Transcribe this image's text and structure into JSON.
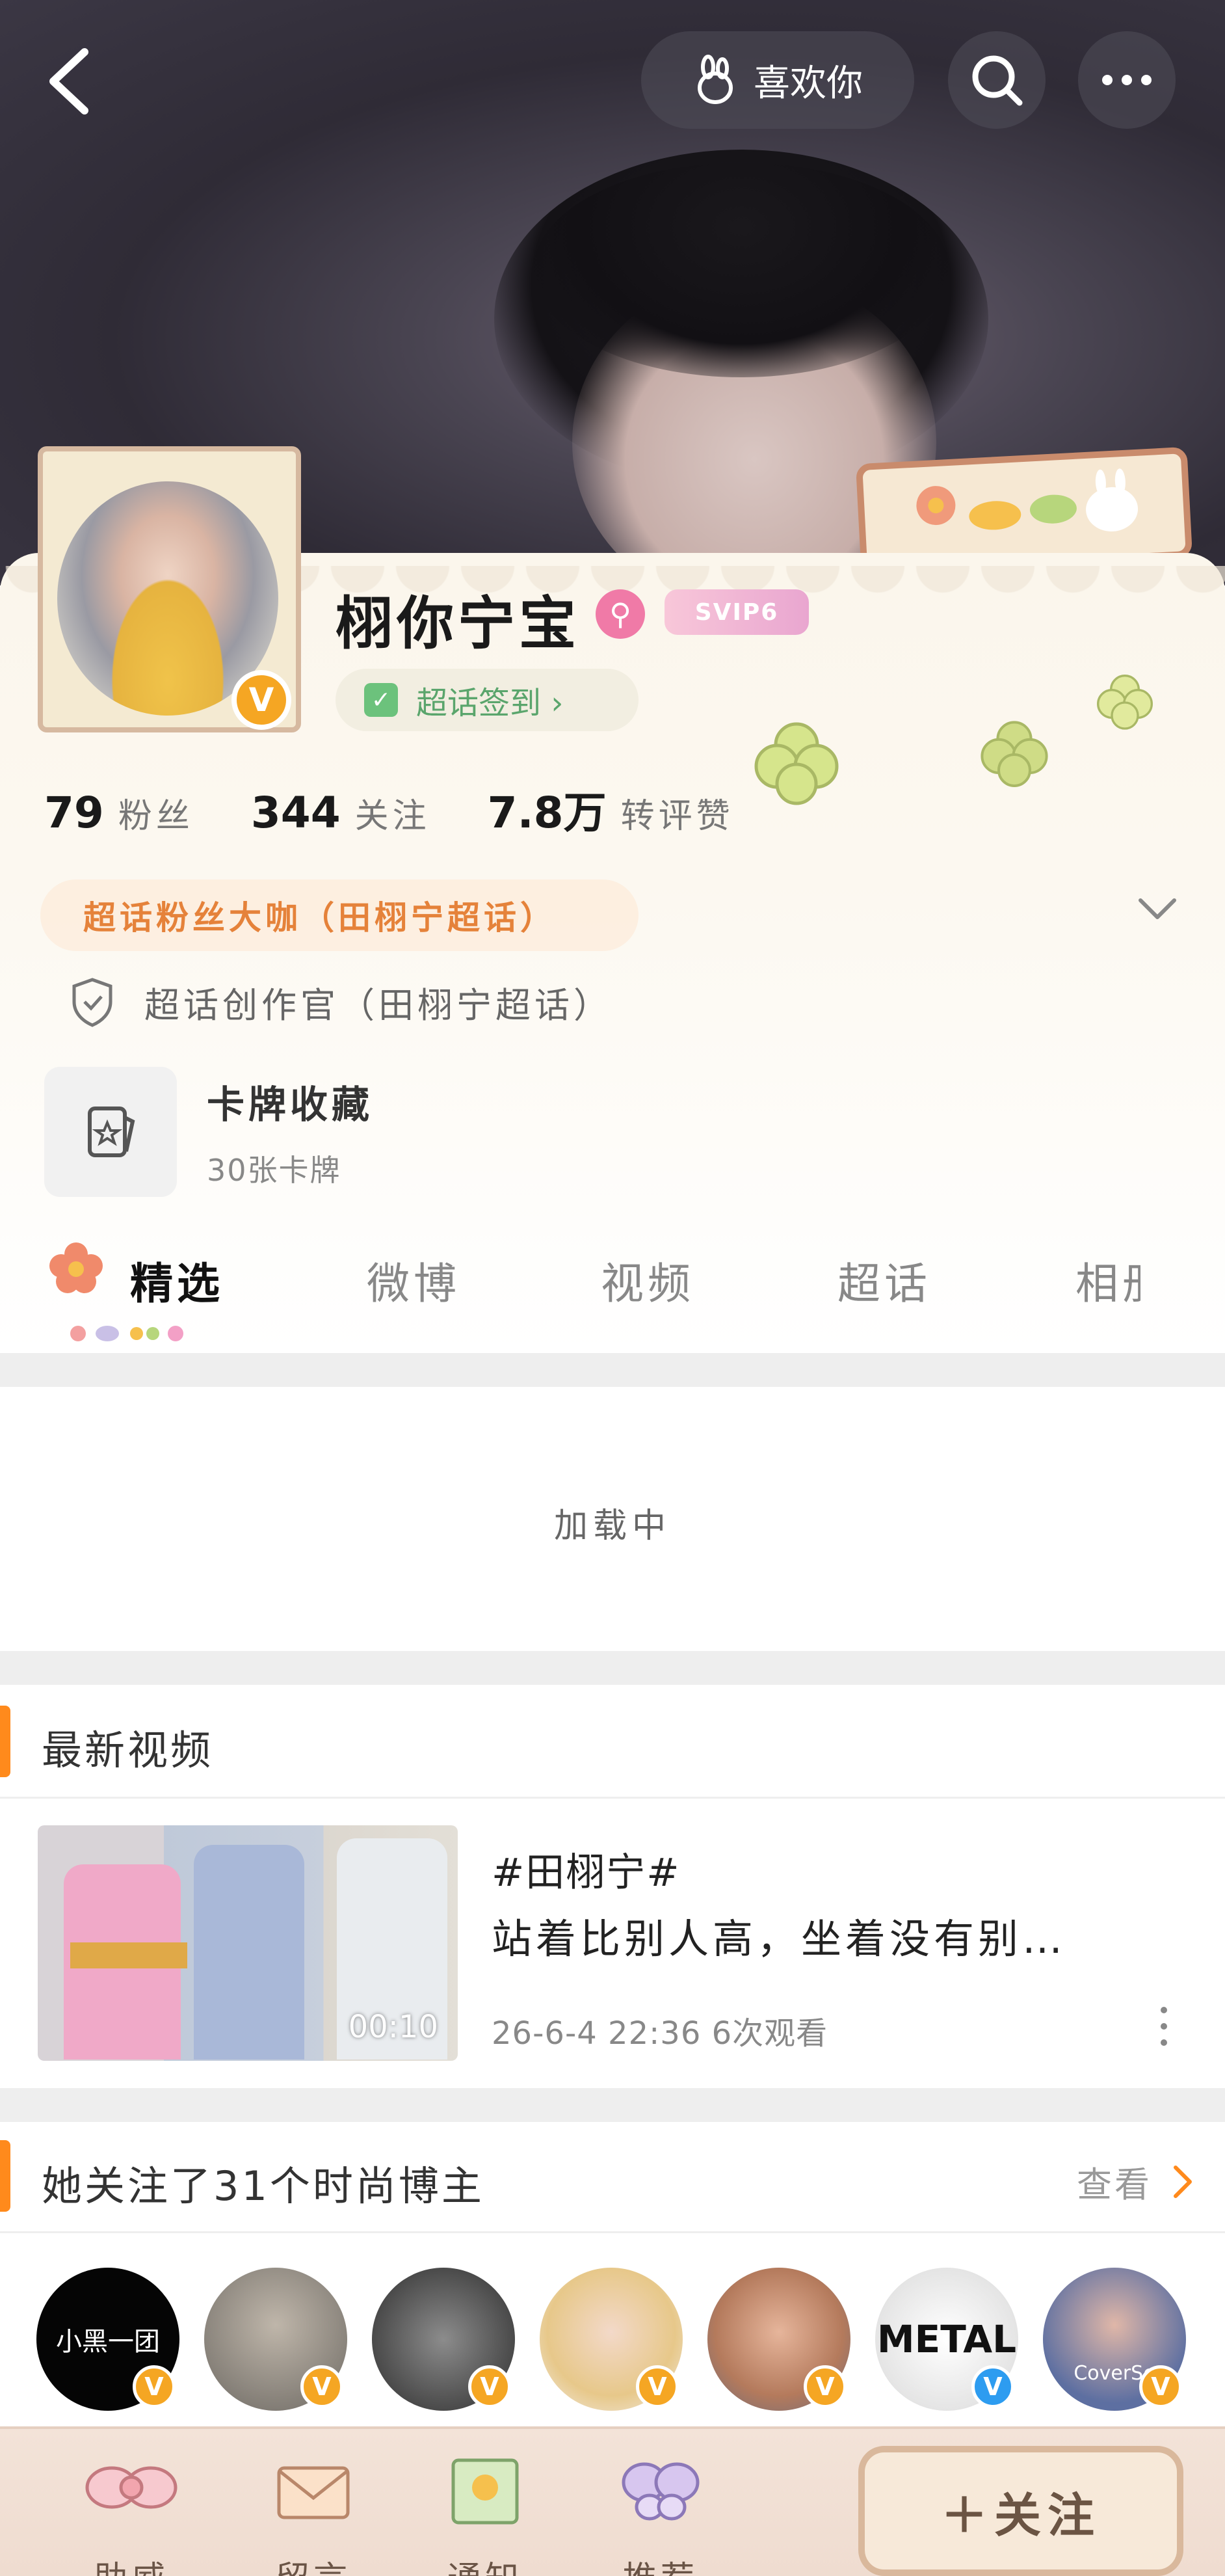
{
  "header": {
    "like_label": "喜欢你"
  },
  "profile": {
    "username": "栩你宁宝",
    "svip_label": "SVIP6",
    "checkin_label": "超话签到 ›",
    "stats": [
      {
        "value": "79",
        "label": "粉丝"
      },
      {
        "value": "344",
        "label": "关注"
      },
      {
        "value": "7.8万",
        "label": "转评赞"
      }
    ],
    "fan_badge": "超话粉丝大咖（田栩宁超话）",
    "creator_label": "超话创作官（田栩宁超话）",
    "cards": {
      "title": "卡牌收藏",
      "subtitle": "30张卡牌"
    }
  },
  "tabs": [
    "精选",
    "微博",
    "视频",
    "超话",
    "相册"
  ],
  "loading_text": "加载中",
  "latest_video": {
    "section_title": "最新视频",
    "duration": "00:10",
    "tag": "#田栩宁#",
    "title": "站着比别人高，坐着没有别…",
    "meta": "26-6-4  22:36  6次观看"
  },
  "follows": {
    "section_title": "她关注了31个时尚博主",
    "view_label": "查看",
    "avatars": [
      {
        "name": "小黑一团",
        "badge_color": "#f5a623"
      },
      {
        "name": "avatar-2",
        "badge_color": "#f5a623"
      },
      {
        "name": "avatar-3",
        "badge_color": "#f5a623"
      },
      {
        "name": "avatar-4",
        "badge_color": "#f5a623"
      },
      {
        "name": "avatar-5",
        "badge_color": "#f5a623"
      },
      {
        "name": "METAL",
        "badge_color": "#2d9cf0"
      },
      {
        "name": "CoverSe",
        "badge_color": "#f5a623"
      }
    ]
  },
  "bottom_bar": {
    "items": [
      "助威",
      "留言",
      "通知",
      "推荐"
    ],
    "follow_label": "＋关注"
  },
  "colors": {
    "accent": "#ff8a1c",
    "fan_badge_text": "#e5823a",
    "checkin_green": "#5aa56c"
  }
}
